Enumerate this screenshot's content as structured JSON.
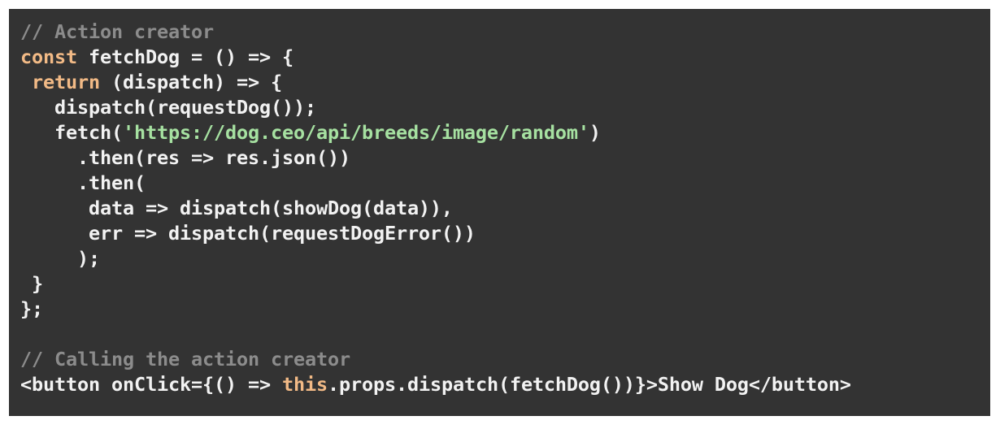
{
  "editor": {
    "panel_background": "#333333",
    "page_background": "#ffffff",
    "language": "javascript-jsx",
    "colors": {
      "comment": "#8c8c8c",
      "keyword": "#f2ba86",
      "string": "#a6e1a1",
      "plain": "#f2f2f2"
    },
    "full_text": "// Action creator\nconst fetchDog = () => {\n return (dispatch) => {\n   dispatch(requestDog());\n   fetch('https://dog.ceo/api/breeds/image/random')\n     .then(res => res.json())\n     .then(\n      data => dispatch(showDog(data)),\n      err => dispatch(requestDogError())\n     );\n }\n};\n\n// Calling the action creator\n<button onClick={() => this.props.dispatch(fetchDog())}>Show Dog</button>",
    "lines": [
      {
        "number": 1,
        "tokens": [
          {
            "text": "// Action creator",
            "type": "comment"
          }
        ]
      },
      {
        "number": 2,
        "tokens": [
          {
            "text": "const",
            "type": "keyword"
          },
          {
            "text": " fetchDog = () => {",
            "type": "plain"
          }
        ]
      },
      {
        "number": 3,
        "tokens": [
          {
            "text": " ",
            "type": "plain"
          },
          {
            "text": "return",
            "type": "keyword"
          },
          {
            "text": " (dispatch) => {",
            "type": "plain"
          }
        ]
      },
      {
        "number": 4,
        "tokens": [
          {
            "text": "   dispatch(requestDog());",
            "type": "plain"
          }
        ]
      },
      {
        "number": 5,
        "tokens": [
          {
            "text": "   fetch(",
            "type": "plain"
          },
          {
            "text": "'https://dog.ceo/api/breeds/image/random'",
            "type": "string"
          },
          {
            "text": ")",
            "type": "plain"
          }
        ]
      },
      {
        "number": 6,
        "tokens": [
          {
            "text": "     .then(res => res.json())",
            "type": "plain"
          }
        ]
      },
      {
        "number": 7,
        "tokens": [
          {
            "text": "     .then(",
            "type": "plain"
          }
        ]
      },
      {
        "number": 8,
        "tokens": [
          {
            "text": "      data => dispatch(showDog(data)),",
            "type": "plain"
          }
        ]
      },
      {
        "number": 9,
        "tokens": [
          {
            "text": "      err => dispatch(requestDogError())",
            "type": "plain"
          }
        ]
      },
      {
        "number": 10,
        "tokens": [
          {
            "text": "     );",
            "type": "plain"
          }
        ]
      },
      {
        "number": 11,
        "tokens": [
          {
            "text": " }",
            "type": "plain"
          }
        ]
      },
      {
        "number": 12,
        "tokens": [
          {
            "text": "};",
            "type": "plain"
          }
        ]
      },
      {
        "number": 13,
        "tokens": []
      },
      {
        "number": 14,
        "tokens": [
          {
            "text": "// Calling the action creator",
            "type": "comment"
          }
        ]
      },
      {
        "number": 15,
        "tokens": [
          {
            "text": "<button onClick={() => ",
            "type": "plain"
          },
          {
            "text": "this",
            "type": "keyword"
          },
          {
            "text": ".props.dispatch(fetchDog())}>Show Dog</button>",
            "type": "plain"
          }
        ]
      }
    ]
  }
}
